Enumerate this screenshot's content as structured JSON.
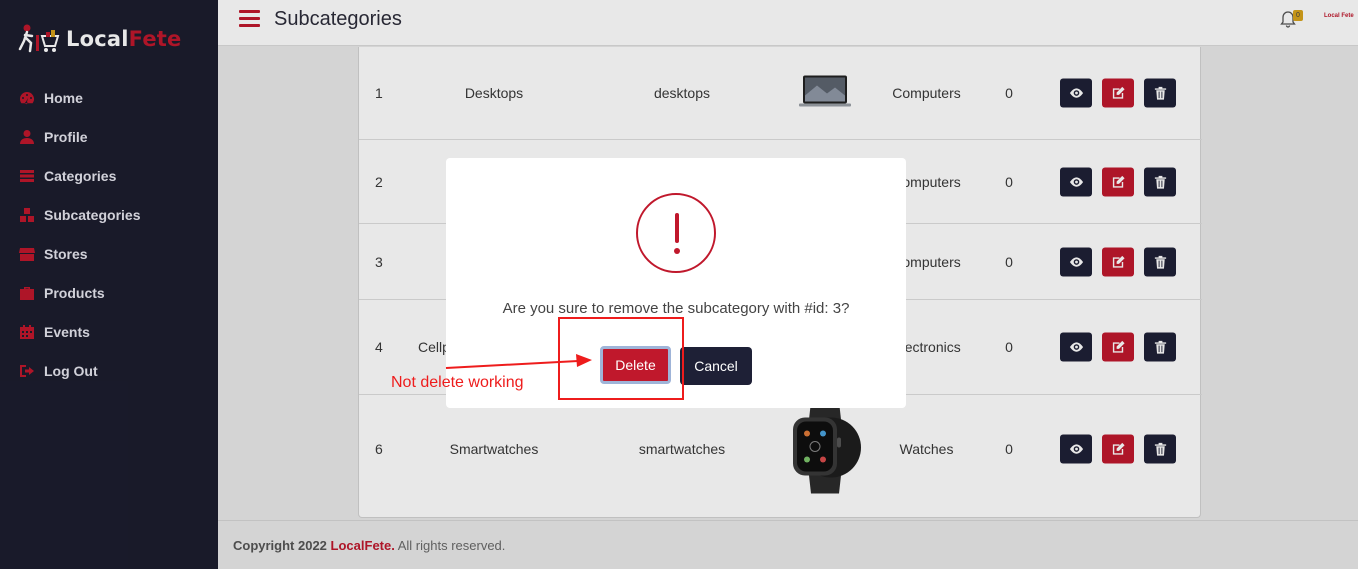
{
  "app": {
    "logo_prefix": "Local",
    "logo_suffix": "Fete",
    "header_brand": "Local Fete",
    "notification_count": "0"
  },
  "sidebar": {
    "items": [
      {
        "label": "Home",
        "icon": "dashboard-icon"
      },
      {
        "label": "Profile",
        "icon": "user-icon"
      },
      {
        "label": "Categories",
        "icon": "categories-icon"
      },
      {
        "label": "Subcategories",
        "icon": "subcategories-icon"
      },
      {
        "label": "Stores",
        "icon": "store-icon"
      },
      {
        "label": "Products",
        "icon": "briefcase-icon"
      },
      {
        "label": "Events",
        "icon": "calendar-icon"
      },
      {
        "label": "Log Out",
        "icon": "logout-icon"
      }
    ]
  },
  "header": {
    "title": "Subcategories"
  },
  "table": {
    "rows": [
      {
        "id": "1",
        "name": "Desktops",
        "slug": "desktops",
        "category": "Computers",
        "count": "0",
        "image": "laptop"
      },
      {
        "id": "2",
        "name": "",
        "slug": "",
        "category": "Computers",
        "count": "0",
        "image": ""
      },
      {
        "id": "3",
        "name": "",
        "slug": "",
        "category": "Computers",
        "count": "0",
        "image": ""
      },
      {
        "id": "4",
        "name": "Cellp",
        "slug": "",
        "category": "Electronics",
        "count": "0",
        "image": ""
      },
      {
        "id": "6",
        "name": "Smartwatches",
        "slug": "smartwatches",
        "category": "Watches",
        "count": "0",
        "image": "smartwatch"
      }
    ]
  },
  "modal": {
    "message": "Are you sure to remove the subcategory with #id: 3?",
    "delete_label": "Delete",
    "cancel_label": "Cancel"
  },
  "annotation": {
    "text": "Not delete working"
  },
  "footer": {
    "prefix": "Copyright 2022",
    "brand": "LocalFete.",
    "suffix": "All rights reserved."
  },
  "colors": {
    "accent": "#c0182c",
    "sidebar_bg": "#1c1d2e",
    "dark_button": "#1e2036",
    "annotation": "#ee1c1c"
  }
}
